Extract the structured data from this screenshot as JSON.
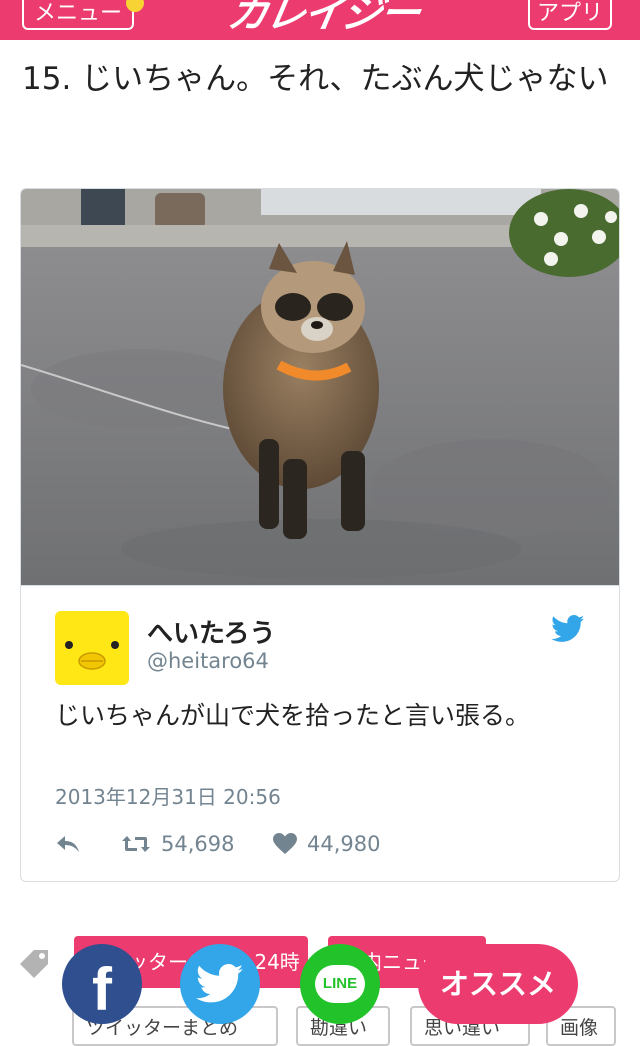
{
  "header": {
    "menu_label": "メニュー",
    "logo_text": "カレイジー",
    "app_label": "アプリ"
  },
  "article": {
    "title": "15. じいちゃん。それ、たぶん犬じゃない"
  },
  "tweet": {
    "user_name": "へいたろう",
    "user_handle": "@heitaro64",
    "text": "じいちゃんが山で犬を拾ったと言い張る。",
    "date": "2013年12月31日 20:56",
    "retweets": "54,698",
    "likes": "44,980"
  },
  "tags": {
    "row1": [
      "ツイッターまとめ 24時",
      "国内ニュース"
    ],
    "row2": [
      "ツイッターまとめ",
      "勘違い",
      "思い違い",
      "画像"
    ]
  },
  "share": {
    "line_label": "LINE",
    "recommend_label": "オススメ"
  },
  "colors": {
    "brand": "#ec3b6e",
    "facebook": "#2f4f8f",
    "twitter": "#33a6ea",
    "line": "#22c22b"
  }
}
